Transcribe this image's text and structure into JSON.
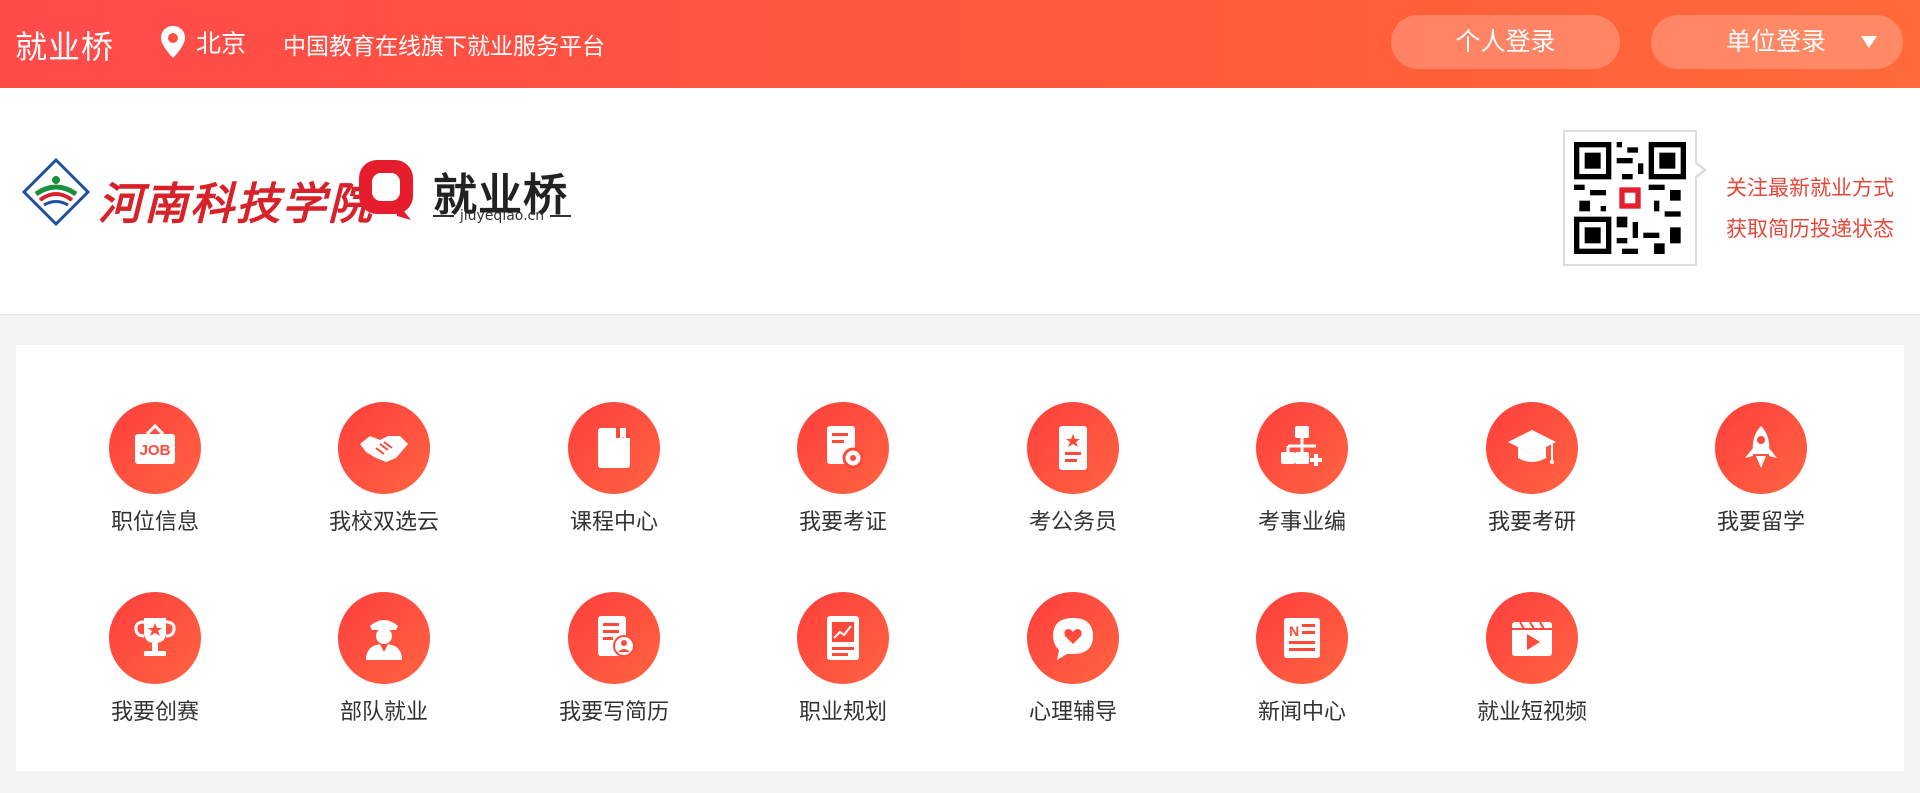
{
  "topbar": {
    "brand": "就业桥",
    "location": "北京",
    "tagline": "中国教育在线旗下就业服务平台",
    "personal_login": "个人登录",
    "company_login": "单位登录"
  },
  "header": {
    "school_name": "河南科技学院",
    "site_name": "就业桥",
    "site_domain": "jiuyeqiao.cn",
    "qr_line1": "关注最新就业方式",
    "qr_line2": "获取简历投递状态"
  },
  "services": [
    {
      "label": "职位信息",
      "icon": "job-icon"
    },
    {
      "label": "我校双选云",
      "icon": "handshake-icon"
    },
    {
      "label": "课程中心",
      "icon": "book-icon"
    },
    {
      "label": "我要考证",
      "icon": "certificate-icon"
    },
    {
      "label": "考公务员",
      "icon": "badge-document-icon"
    },
    {
      "label": "考事业编",
      "icon": "org-chart-icon"
    },
    {
      "label": "我要考研",
      "icon": "graduation-cap-icon"
    },
    {
      "label": "我要留学",
      "icon": "rocket-icon"
    },
    {
      "label": "我要创赛",
      "icon": "trophy-icon"
    },
    {
      "label": "部队就业",
      "icon": "soldier-icon"
    },
    {
      "label": "我要写简历",
      "icon": "resume-icon"
    },
    {
      "label": "职业规划",
      "icon": "career-chart-icon"
    },
    {
      "label": "心理辅导",
      "icon": "heart-chat-icon"
    },
    {
      "label": "新闻中心",
      "icon": "newspaper-icon"
    },
    {
      "label": "就业短视频",
      "icon": "video-icon"
    }
  ]
}
